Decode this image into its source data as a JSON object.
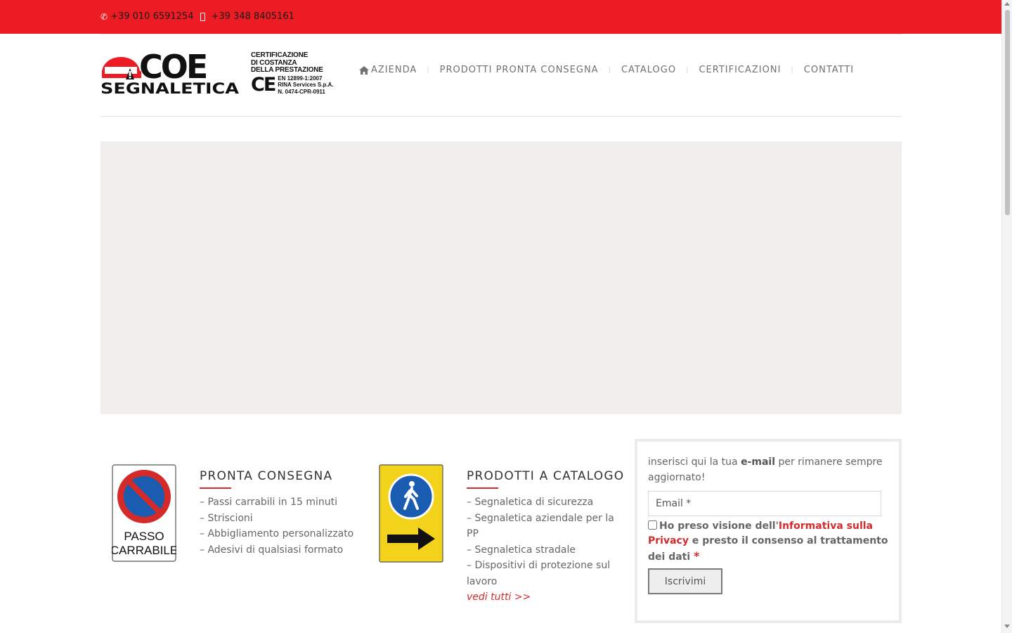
{
  "topbar": {
    "phone": "+39 010 6591254",
    "mobile": "+39 348 8405161",
    "phone_icon": "phone-icon",
    "mobile_icon": "mobile-phone-icon"
  },
  "logo": {
    "brand_top": "COE",
    "brand_bottom": "SEGNALETICA",
    "cert_line1": "CERTIFICAZIONE",
    "cert_line2": "DI COSTANZA",
    "cert_line3": "DELLA PRESTAZIONE",
    "ce_mark": "CE",
    "ce_line1": "EN 12899-1:2007",
    "ce_line2": "RINA Services S.p.A.",
    "ce_line3": "N. 0474-CPR-0911"
  },
  "nav": {
    "items": [
      {
        "label": "AZIENDA",
        "icon": "home-icon"
      },
      {
        "label": "PRODOTTI PRONTA CONSEGNA"
      },
      {
        "label": "CATALOGO"
      },
      {
        "label": "CERTIFICAZIONI"
      },
      {
        "label": "CONTATTI"
      }
    ],
    "separator": "|"
  },
  "pronta": {
    "title": "PRONTA CONSEGNA",
    "sign_text_1": "PASSO",
    "sign_text_2": "CARRABILE",
    "items": [
      "– Passi carrabili in 15 minuti",
      "– Striscioni",
      "– Abbigliamento personalizzato",
      "– Adesivi di qualsiasi formato"
    ]
  },
  "catalogo": {
    "title": "PRODOTTI A CATALOGO",
    "items": [
      "– Segnaletica di sicurezza",
      "– Segnaletica aziendale per la PP",
      "– Segnaletica stradale",
      "– Dispositivi di protezione sul lavoro"
    ],
    "more_link": "vedi tutti >>"
  },
  "newsletter": {
    "intro_pre": "inserisci qui la tua ",
    "intro_bold": "e-mail",
    "intro_post": " per rimanere sempre aggiornato!",
    "email_placeholder": "Email *",
    "consent_pre": "Ho preso visione dell'",
    "consent_link": "Informativa sulla Privacy",
    "consent_post": " e presto il consenso al trattamento dei dati ",
    "required_mark": "*",
    "submit_label": "Iscrivimi"
  },
  "colors": {
    "accent_red": "#ed1c24",
    "link_red": "#d52b2b",
    "slider_bg": "#f0efed"
  }
}
